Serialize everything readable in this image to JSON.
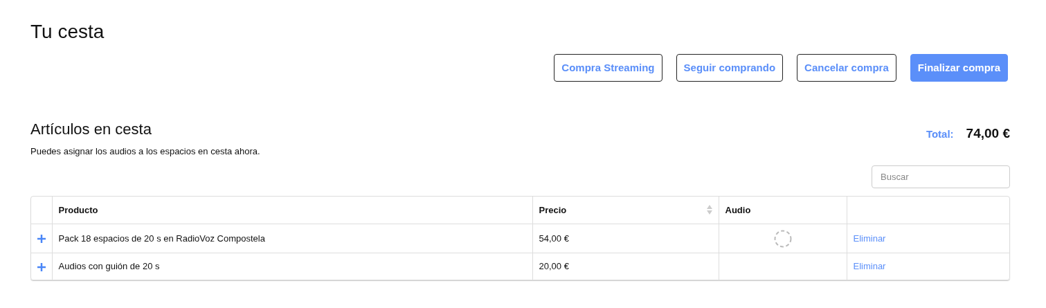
{
  "title": "Tu cesta",
  "buttons": [
    {
      "label": "Compra Streaming",
      "kind": "outline"
    },
    {
      "label": "Seguir comprando",
      "kind": "outline"
    },
    {
      "label": "Cancelar compra",
      "kind": "outline"
    },
    {
      "label": "Finalizar compra",
      "kind": "primary"
    }
  ],
  "section": {
    "heading": "Artículos en cesta",
    "subtitle": "Puedes asignar los audios a los espacios en cesta ahora.",
    "total_label": "Total:",
    "total_value": "74,00 €"
  },
  "search": {
    "placeholder": "Buscar"
  },
  "table": {
    "columns": [
      {
        "label": "Producto",
        "sortable": false
      },
      {
        "label": "Precio",
        "sortable": true
      },
      {
        "label": "Audio",
        "sortable": false
      }
    ],
    "rows": [
      {
        "product": "Pack 18 espacios de 20 s en RadioVoz Compostela",
        "price": "54,00 €",
        "audio_loading": true,
        "action": "Eliminar"
      },
      {
        "product": "Audios con guión de 20 s",
        "price": "20,00 €",
        "audio_loading": false,
        "action": "Eliminar"
      }
    ]
  }
}
